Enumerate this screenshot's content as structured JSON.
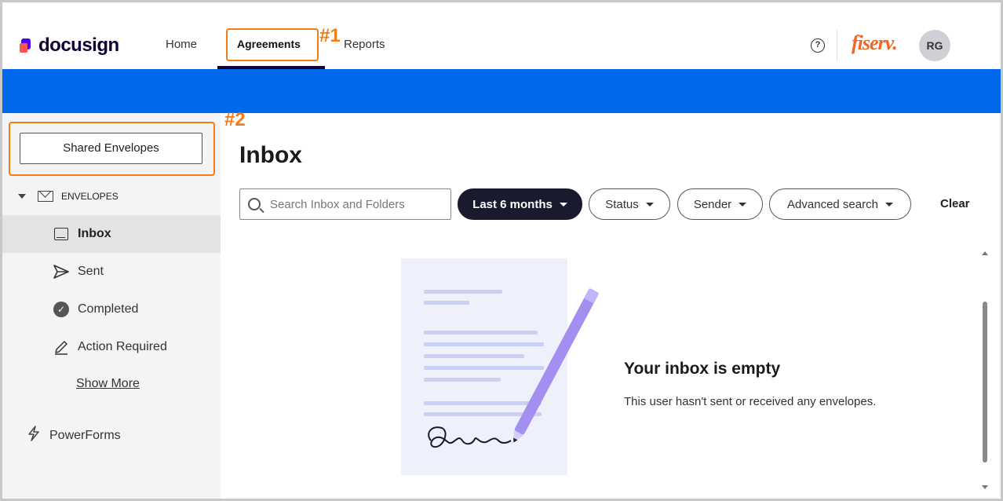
{
  "header": {
    "logo_text": "docusign",
    "nav": {
      "home": "Home",
      "agreements": "Agreements",
      "reports": "Reports"
    },
    "help_symbol": "?",
    "brand": "fiserv.",
    "avatar_initials": "RG",
    "brand_color": "#f26722",
    "accent_color": "#0069ec"
  },
  "annotations": {
    "label_1": "#1",
    "label_2": "#2",
    "highlight_color": "#f07d1a"
  },
  "sidebar": {
    "shared_button": "Shared Envelopes",
    "section_label": "ENVELOPES",
    "items": [
      {
        "label": "Inbox",
        "icon": "inbox-icon",
        "active": true
      },
      {
        "label": "Sent",
        "icon": "send-icon",
        "active": false
      },
      {
        "label": "Completed",
        "icon": "check-circle-icon",
        "active": false
      },
      {
        "label": "Action Required",
        "icon": "pencil-icon",
        "active": false
      }
    ],
    "show_more": "Show More",
    "powerforms": "PowerForms"
  },
  "main": {
    "title": "Inbox",
    "search_placeholder": "Search Inbox and Folders",
    "filters": {
      "date": "Last 6 months",
      "status": "Status",
      "sender": "Sender",
      "advanced": "Advanced search"
    },
    "clear": "Clear",
    "empty_title": "Your inbox is empty",
    "empty_subtitle": "This user hasn't sent or received any envelopes."
  }
}
